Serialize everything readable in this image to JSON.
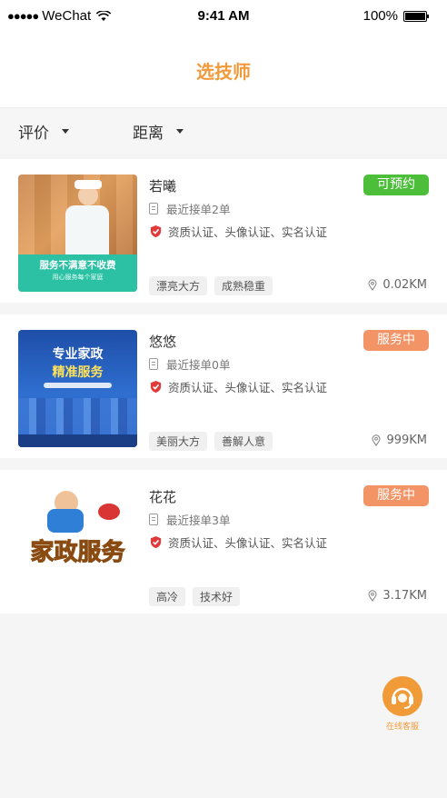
{
  "status_bar": {
    "carrier": "WeChat",
    "time": "9:41 AM",
    "battery": "100%"
  },
  "header": {
    "title": "选技师"
  },
  "filters": [
    {
      "label": "评价"
    },
    {
      "label": "距离"
    }
  ],
  "technicians": [
    {
      "name": "若曦",
      "status": "可预约",
      "status_color": "#4cbe3a",
      "orders": "最近接单2单",
      "certifications": "资质认证、头像认证、实名认证",
      "tags": [
        "漂亮大方",
        "成熟稳重"
      ],
      "distance": "0.02KM",
      "photo_text": "服务不满意不收费",
      "photo_subtext": "用心服务每个家庭"
    },
    {
      "name": "悠悠",
      "status": "服务中",
      "status_color": "#f39467",
      "orders": "最近接单0单",
      "certifications": "资质认证、头像认证、实名认证",
      "tags": [
        "美丽大方",
        "善解人意"
      ],
      "distance": "999KM",
      "photo_text": "专业家政",
      "photo_text2": "精准服务"
    },
    {
      "name": "花花",
      "status": "服务中",
      "status_color": "#f39467",
      "orders": "最近接单3单",
      "certifications": "资质认证、头像认证、实名认证",
      "tags": [
        "高冷",
        "技术好"
      ],
      "distance": "3.17KM",
      "photo_text": "家政服务"
    }
  ],
  "customer_service": {
    "label": "在线客服"
  }
}
